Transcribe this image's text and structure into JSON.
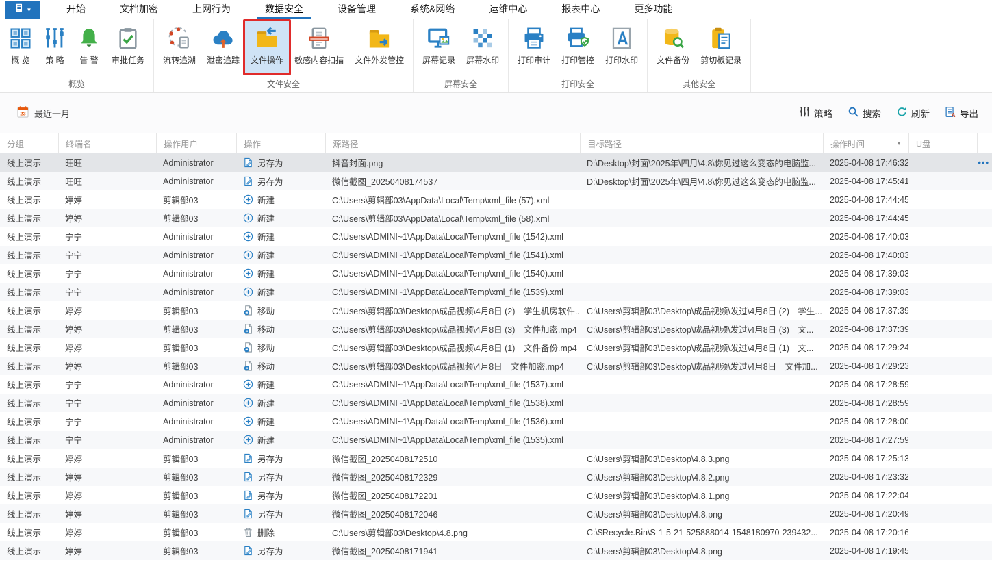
{
  "colors": {
    "accent": "#2173bd",
    "annotation_red": "#e02b2b",
    "folder_yellow": "#f2b718",
    "selected_row": "#e3e5e8"
  },
  "menubar": {
    "app_icon": "app-menu-icon",
    "tabs": [
      {
        "name": "home",
        "label": "开始",
        "active": false
      },
      {
        "name": "doc-encryption",
        "label": "文档加密",
        "active": false
      },
      {
        "name": "web-behavior",
        "label": "上网行为",
        "active": false
      },
      {
        "name": "data-security",
        "label": "数据安全",
        "active": true
      },
      {
        "name": "device-mgmt",
        "label": "设备管理",
        "active": false
      },
      {
        "name": "system-network",
        "label": "系统&网络",
        "active": false
      },
      {
        "name": "ops-center",
        "label": "运维中心",
        "active": false
      },
      {
        "name": "report-center",
        "label": "报表中心",
        "active": false
      },
      {
        "name": "more-features",
        "label": "更多功能",
        "active": false
      }
    ]
  },
  "ribbon": {
    "groups": [
      {
        "label": "概览",
        "buttons": [
          {
            "label": "概 览",
            "icon": "overview"
          },
          {
            "label": "策 略",
            "icon": "policy"
          },
          {
            "label": "告 警",
            "icon": "alert"
          },
          {
            "label": "审批任务",
            "icon": "approval"
          }
        ]
      },
      {
        "label": "文件安全",
        "buttons": [
          {
            "label": "流转追溯",
            "icon": "trace"
          },
          {
            "label": "泄密追踪",
            "icon": "leak"
          },
          {
            "label": "文件操作",
            "icon": "fileops",
            "selected": true,
            "annotated": true
          },
          {
            "label": "敏感内容扫描",
            "icon": "scan"
          },
          {
            "label": "文件外发管控",
            "icon": "outgoing"
          }
        ]
      },
      {
        "label": "屏幕安全",
        "buttons": [
          {
            "label": "屏幕记录",
            "icon": "screenrec"
          },
          {
            "label": "屏幕水印",
            "icon": "screenwm"
          }
        ]
      },
      {
        "label": "打印安全",
        "buttons": [
          {
            "label": "打印审计",
            "icon": "printaudit"
          },
          {
            "label": "打印管控",
            "icon": "printctrl"
          },
          {
            "label": "打印水印",
            "icon": "printwm"
          }
        ]
      },
      {
        "label": "其他安全",
        "buttons": [
          {
            "label": "文件备份",
            "icon": "backup"
          },
          {
            "label": "剪切板记录",
            "icon": "clipboard"
          }
        ]
      }
    ]
  },
  "toolbar": {
    "date_filter": {
      "icon": "calendar",
      "day": "23",
      "label": "最近一月"
    },
    "actions": [
      {
        "name": "policy",
        "icon": "sliders2",
        "label": "策略"
      },
      {
        "name": "search",
        "icon": "search",
        "label": "搜索"
      },
      {
        "name": "refresh",
        "icon": "refresh",
        "label": "刷新"
      },
      {
        "name": "export",
        "icon": "export",
        "label": "导出"
      }
    ]
  },
  "table": {
    "columns": [
      "分组",
      "终端名",
      "操作用户",
      "操作",
      "源路径",
      "目标路径",
      "操作时间",
      "U盘"
    ],
    "sort_column": "操作时间",
    "sort_direction": "desc",
    "rows": [
      {
        "group": "线上演示",
        "terminal": "旺旺",
        "user": "Administrator",
        "op": "另存为",
        "op_icon": "saveas",
        "src": "抖音封面.png",
        "dst": "D:\\Desktop\\封面\\2025年\\四月\\4.8\\你见过这么变态的电脑监...",
        "time": "2025-04-08 17:46:32",
        "selected": true,
        "menu": "•••"
      },
      {
        "group": "线上演示",
        "terminal": "旺旺",
        "user": "Administrator",
        "op": "另存为",
        "op_icon": "saveas",
        "src": "微信截图_20250408174537",
        "dst": "D:\\Desktop\\封面\\2025年\\四月\\4.8\\你见过这么变态的电脑监...",
        "time": "2025-04-08 17:45:41"
      },
      {
        "group": "线上演示",
        "terminal": "婷婷",
        "user": "剪辑部03",
        "op": "新建",
        "op_icon": "newdoc",
        "src": "C:\\Users\\剪辑部03\\AppData\\Local\\Temp\\xml_file (57).xml",
        "dst": "",
        "time": "2025-04-08 17:44:45"
      },
      {
        "group": "线上演示",
        "terminal": "婷婷",
        "user": "剪辑部03",
        "op": "新建",
        "op_icon": "newdoc",
        "src": "C:\\Users\\剪辑部03\\AppData\\Local\\Temp\\xml_file (58).xml",
        "dst": "",
        "time": "2025-04-08 17:44:45"
      },
      {
        "group": "线上演示",
        "terminal": "宁宁",
        "user": "Administrator",
        "op": "新建",
        "op_icon": "newdoc",
        "src": "C:\\Users\\ADMINI~1\\AppData\\Local\\Temp\\xml_file (1542).xml",
        "dst": "",
        "time": "2025-04-08 17:40:03"
      },
      {
        "group": "线上演示",
        "terminal": "宁宁",
        "user": "Administrator",
        "op": "新建",
        "op_icon": "newdoc",
        "src": "C:\\Users\\ADMINI~1\\AppData\\Local\\Temp\\xml_file (1541).xml",
        "dst": "",
        "time": "2025-04-08 17:40:03"
      },
      {
        "group": "线上演示",
        "terminal": "宁宁",
        "user": "Administrator",
        "op": "新建",
        "op_icon": "newdoc",
        "src": "C:\\Users\\ADMINI~1\\AppData\\Local\\Temp\\xml_file (1540).xml",
        "dst": "",
        "time": "2025-04-08 17:39:03"
      },
      {
        "group": "线上演示",
        "terminal": "宁宁",
        "user": "Administrator",
        "op": "新建",
        "op_icon": "newdoc",
        "src": "C:\\Users\\ADMINI~1\\AppData\\Local\\Temp\\xml_file (1539).xml",
        "dst": "",
        "time": "2025-04-08 17:39:03"
      },
      {
        "group": "线上演示",
        "terminal": "婷婷",
        "user": "剪辑部03",
        "op": "移动",
        "op_icon": "move",
        "src": "C:\\Users\\剪辑部03\\Desktop\\成品视频\\4月8日 (2)　学生机房软件...",
        "dst": "C:\\Users\\剪辑部03\\Desktop\\成品视频\\发过\\4月8日 (2)　学生...",
        "time": "2025-04-08 17:37:39"
      },
      {
        "group": "线上演示",
        "terminal": "婷婷",
        "user": "剪辑部03",
        "op": "移动",
        "op_icon": "move",
        "src": "C:\\Users\\剪辑部03\\Desktop\\成品视频\\4月8日 (3)　文件加密.mp4",
        "dst": "C:\\Users\\剪辑部03\\Desktop\\成品视频\\发过\\4月8日 (3)　文...",
        "time": "2025-04-08 17:37:39"
      },
      {
        "group": "线上演示",
        "terminal": "婷婷",
        "user": "剪辑部03",
        "op": "移动",
        "op_icon": "move",
        "src": "C:\\Users\\剪辑部03\\Desktop\\成品视频\\4月8日 (1)　文件备份.mp4",
        "dst": "C:\\Users\\剪辑部03\\Desktop\\成品视频\\发过\\4月8日 (1)　文...",
        "time": "2025-04-08 17:29:24"
      },
      {
        "group": "线上演示",
        "terminal": "婷婷",
        "user": "剪辑部03",
        "op": "移动",
        "op_icon": "move",
        "src": "C:\\Users\\剪辑部03\\Desktop\\成品视频\\4月8日　文件加密.mp4",
        "dst": "C:\\Users\\剪辑部03\\Desktop\\成品视频\\发过\\4月8日　文件加...",
        "time": "2025-04-08 17:29:23"
      },
      {
        "group": "线上演示",
        "terminal": "宁宁",
        "user": "Administrator",
        "op": "新建",
        "op_icon": "newdoc",
        "src": "C:\\Users\\ADMINI~1\\AppData\\Local\\Temp\\xml_file (1537).xml",
        "dst": "",
        "time": "2025-04-08 17:28:59"
      },
      {
        "group": "线上演示",
        "terminal": "宁宁",
        "user": "Administrator",
        "op": "新建",
        "op_icon": "newdoc",
        "src": "C:\\Users\\ADMINI~1\\AppData\\Local\\Temp\\xml_file (1538).xml",
        "dst": "",
        "time": "2025-04-08 17:28:59"
      },
      {
        "group": "线上演示",
        "terminal": "宁宁",
        "user": "Administrator",
        "op": "新建",
        "op_icon": "newdoc",
        "src": "C:\\Users\\ADMINI~1\\AppData\\Local\\Temp\\xml_file (1536).xml",
        "dst": "",
        "time": "2025-04-08 17:28:00"
      },
      {
        "group": "线上演示",
        "terminal": "宁宁",
        "user": "Administrator",
        "op": "新建",
        "op_icon": "newdoc",
        "src": "C:\\Users\\ADMINI~1\\AppData\\Local\\Temp\\xml_file (1535).xml",
        "dst": "",
        "time": "2025-04-08 17:27:59"
      },
      {
        "group": "线上演示",
        "terminal": "婷婷",
        "user": "剪辑部03",
        "op": "另存为",
        "op_icon": "saveas",
        "src": "微信截图_20250408172510",
        "dst": "C:\\Users\\剪辑部03\\Desktop\\4.8.3.png",
        "time": "2025-04-08 17:25:13"
      },
      {
        "group": "线上演示",
        "terminal": "婷婷",
        "user": "剪辑部03",
        "op": "另存为",
        "op_icon": "saveas",
        "src": "微信截图_20250408172329",
        "dst": "C:\\Users\\剪辑部03\\Desktop\\4.8.2.png",
        "time": "2025-04-08 17:23:32"
      },
      {
        "group": "线上演示",
        "terminal": "婷婷",
        "user": "剪辑部03",
        "op": "另存为",
        "op_icon": "saveas",
        "src": "微信截图_20250408172201",
        "dst": "C:\\Users\\剪辑部03\\Desktop\\4.8.1.png",
        "time": "2025-04-08 17:22:04"
      },
      {
        "group": "线上演示",
        "terminal": "婷婷",
        "user": "剪辑部03",
        "op": "另存为",
        "op_icon": "saveas",
        "src": "微信截图_20250408172046",
        "dst": "C:\\Users\\剪辑部03\\Desktop\\4.8.png",
        "time": "2025-04-08 17:20:49"
      },
      {
        "group": "线上演示",
        "terminal": "婷婷",
        "user": "剪辑部03",
        "op": "删除",
        "op_icon": "del",
        "src": "C:\\Users\\剪辑部03\\Desktop\\4.8.png",
        "dst": "C:\\$Recycle.Bin\\S-1-5-21-525888014-1548180970-239432...",
        "time": "2025-04-08 17:20:16"
      },
      {
        "group": "线上演示",
        "terminal": "婷婷",
        "user": "剪辑部03",
        "op": "另存为",
        "op_icon": "saveas",
        "src": "微信截图_20250408171941",
        "dst": "C:\\Users\\剪辑部03\\Desktop\\4.8.png",
        "time": "2025-04-08 17:19:45"
      }
    ]
  }
}
